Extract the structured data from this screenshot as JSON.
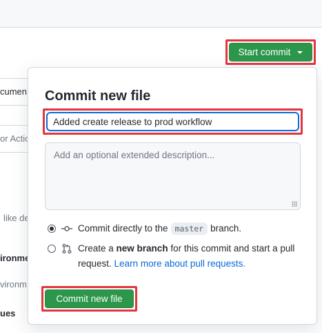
{
  "background": {
    "fragments": [
      "cumen",
      "or Actio",
      "like de",
      "ironme",
      "vironm",
      "ues"
    ]
  },
  "header": {
    "start_commit_label": "Start commit"
  },
  "commit_panel": {
    "title": "Commit new file",
    "summary_value": "Added create release to prod workflow",
    "description_placeholder": "Add an optional extended description...",
    "options": [
      {
        "label_pre": "Commit directly to the",
        "branch": "master",
        "label_post": "branch.",
        "selected": true
      },
      {
        "label_pre": "Create a",
        "label_bold": "new branch",
        "label_post": "for this commit and start a pull",
        "label_line2": "request.",
        "link": "Learn more about pull requests.",
        "selected": false
      }
    ],
    "commit_button_label": "Commit new file"
  },
  "colors": {
    "primary_green": "#2c974b",
    "highlight_red": "#e3343d",
    "link_blue": "#0969da"
  }
}
